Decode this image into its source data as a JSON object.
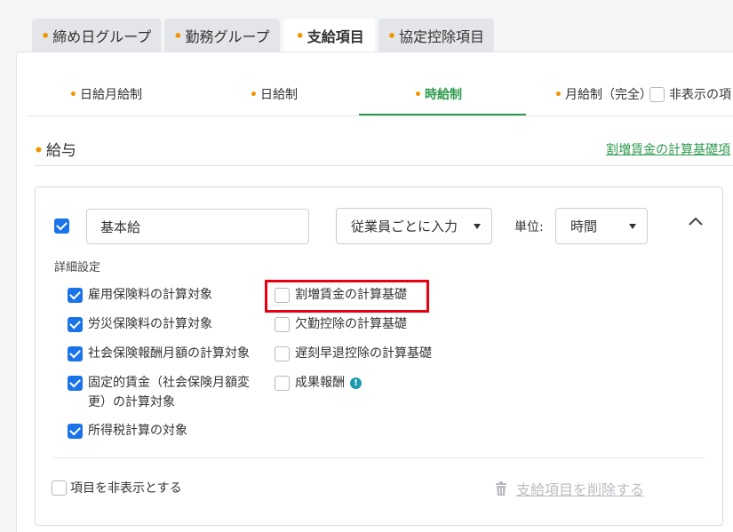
{
  "top_tabs": [
    {
      "label": "締め日グループ"
    },
    {
      "label": "勤務グループ"
    },
    {
      "label": "支給項目"
    },
    {
      "label": "協定控除項目"
    }
  ],
  "sub_tabs": [
    {
      "label": "日給月給制"
    },
    {
      "label": "日給制"
    },
    {
      "label": "時給制"
    },
    {
      "label": "月給制（完全）"
    }
  ],
  "hidden_items_label": "非表示の項",
  "section": {
    "title": "給与",
    "link": "割増賃金の計算基礎項"
  },
  "item": {
    "name_value": "基本給",
    "input_mode": "従業員ごとに入力",
    "unit_label": "単位:",
    "unit_value": "時間",
    "detail_label": "詳細設定",
    "options_left": [
      {
        "label": "雇用保険料の計算対象",
        "checked": true
      },
      {
        "label": "労災保険料の計算対象",
        "checked": true
      },
      {
        "label": "社会保険報酬月額の計算対象",
        "checked": true
      },
      {
        "label": "固定的賃金（社会保険月額変",
        "label2": "更）の計算対象",
        "checked": true
      },
      {
        "label": "所得税計算の対象",
        "checked": true
      }
    ],
    "options_right": [
      {
        "label": "割増賃金の計算基礎",
        "checked": false
      },
      {
        "label": "欠勤控除の計算基礎",
        "checked": false
      },
      {
        "label": "遅刻早退控除の計算基礎",
        "checked": false
      },
      {
        "label": "成果報酬",
        "checked": false
      }
    ],
    "hide_label": "項目を非表示とする",
    "delete_label": "支給項目を削除する"
  },
  "colors": {
    "accent": "#2e9a4d",
    "checkbox": "#1a73e8",
    "highlight": "#e60012",
    "dot": "#f29600"
  }
}
